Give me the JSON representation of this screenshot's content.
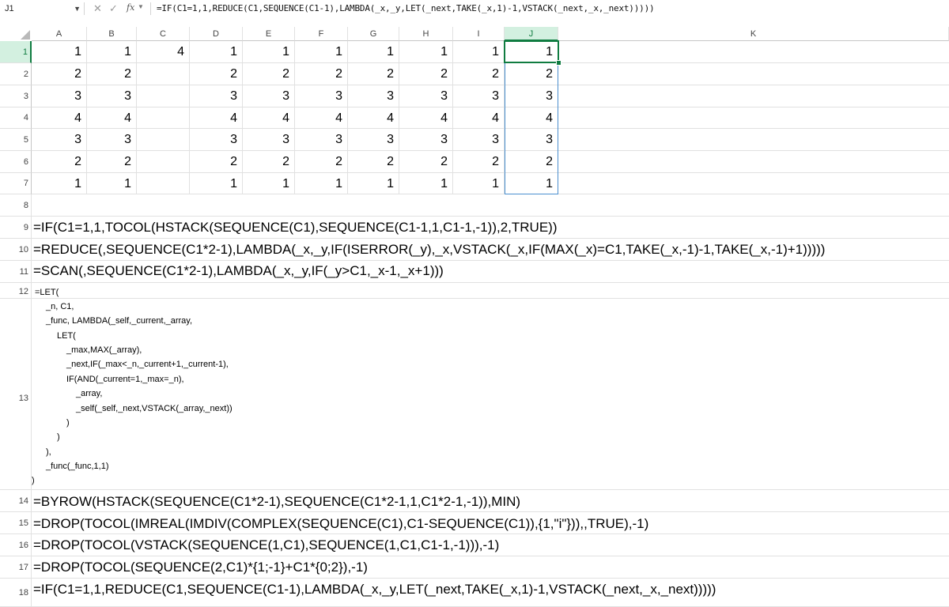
{
  "formula_bar": {
    "name_box": "J1",
    "name_box_dropdown_icon": "chevron-down-icon",
    "cancel_icon": "close-icon",
    "enter_icon": "check-icon",
    "fx_label": "fx",
    "formula": "=IF(C1=1,1,REDUCE(C1,SEQUENCE(C1-1),LAMBDA(_x,_y,LET(_next,TAKE(_x,1)-1,VSTACK(_next,_x,_next)))))"
  },
  "columns": [
    "A",
    "B",
    "C",
    "D",
    "E",
    "F",
    "G",
    "H",
    "I",
    "J",
    "K"
  ],
  "selected_column": "J",
  "row_numbers": [
    "1",
    "2",
    "3",
    "4",
    "5",
    "6",
    "7",
    "8",
    "9",
    "10",
    "11",
    "12",
    "13",
    "14",
    "15",
    "16",
    "17",
    "18"
  ],
  "selected_row": "1",
  "c1_value": "4",
  "value_columns": [
    "A",
    "B",
    "D",
    "E",
    "F",
    "G",
    "H",
    "I",
    "J"
  ],
  "value_rows": [
    {
      "row": "1",
      "values": [
        "1",
        "1",
        "1",
        "1",
        "1",
        "1",
        "1",
        "1",
        "1"
      ]
    },
    {
      "row": "2",
      "values": [
        "2",
        "2",
        "2",
        "2",
        "2",
        "2",
        "2",
        "2",
        "2"
      ]
    },
    {
      "row": "3",
      "values": [
        "3",
        "3",
        "3",
        "3",
        "3",
        "3",
        "3",
        "3",
        "3"
      ]
    },
    {
      "row": "4",
      "values": [
        "4",
        "4",
        "4",
        "4",
        "4",
        "4",
        "4",
        "4",
        "4"
      ]
    },
    {
      "row": "5",
      "values": [
        "3",
        "3",
        "3",
        "3",
        "3",
        "3",
        "3",
        "3",
        "3"
      ]
    },
    {
      "row": "6",
      "values": [
        "2",
        "2",
        "2",
        "2",
        "2",
        "2",
        "2",
        "2",
        "2"
      ]
    },
    {
      "row": "7",
      "values": [
        "1",
        "1",
        "1",
        "1",
        "1",
        "1",
        "1",
        "1",
        "1"
      ]
    }
  ],
  "formula_rows": {
    "r9": "=IF(C1=1,1,TOCOL(HSTACK(SEQUENCE(C1),SEQUENCE(C1-1,1,C1-1,-1)),2,TRUE))",
    "r10": "=REDUCE(,SEQUENCE(C1*2-1),LAMBDA(_x,_y,IF(ISERROR(_y),_x,VSTACK(_x,IF(MAX(_x)=C1,TAKE(_x,-1)-1,TAKE(_x,-1)+1)))))",
    "r11": "=SCAN(,SEQUENCE(C1*2-1),LAMBDA(_x,_y,IF(_y>C1,_x-1,_x+1)))",
    "r14": "=BYROW(HSTACK(SEQUENCE(C1*2-1),SEQUENCE(C1*2-1,1,C1*2-1,-1)),MIN)",
    "r15": "=DROP(TOCOL(IMREAL(IMDIV(COMPLEX(SEQUENCE(C1),C1-SEQUENCE(C1)),{1,\"i\"})),,TRUE),-1)",
    "r16": "=DROP(TOCOL(VSTACK(SEQUENCE(1,C1),SEQUENCE(1,C1,C1-1,-1))),-1)",
    "r17": "=DROP(TOCOL(SEQUENCE(2,C1)*{1;-1}+C1*{0;2}),-1)",
    "r18": "=IF(C1=1,1,REDUCE(C1,SEQUENCE(C1-1),LAMBDA(_x,_y,LET(_next,TAKE(_x,1)-1,VSTACK(_next,_x,_next)))))"
  },
  "let_formula_lines": [
    "=LET(",
    "_n, C1,",
    "_func, LAMBDA(_self,_current,_array,",
    "LET(",
    "_max,MAX(_array),",
    "_next,IF(_max<_n,_current+1,_current-1),",
    "IF(AND(_current=1,_max=_n),",
    "_array,",
    "_self(_self,_next,VSTACK(_array,_next))",
    ")",
    ")",
    "),",
    "_func(_func,1,1)",
    ")"
  ]
}
